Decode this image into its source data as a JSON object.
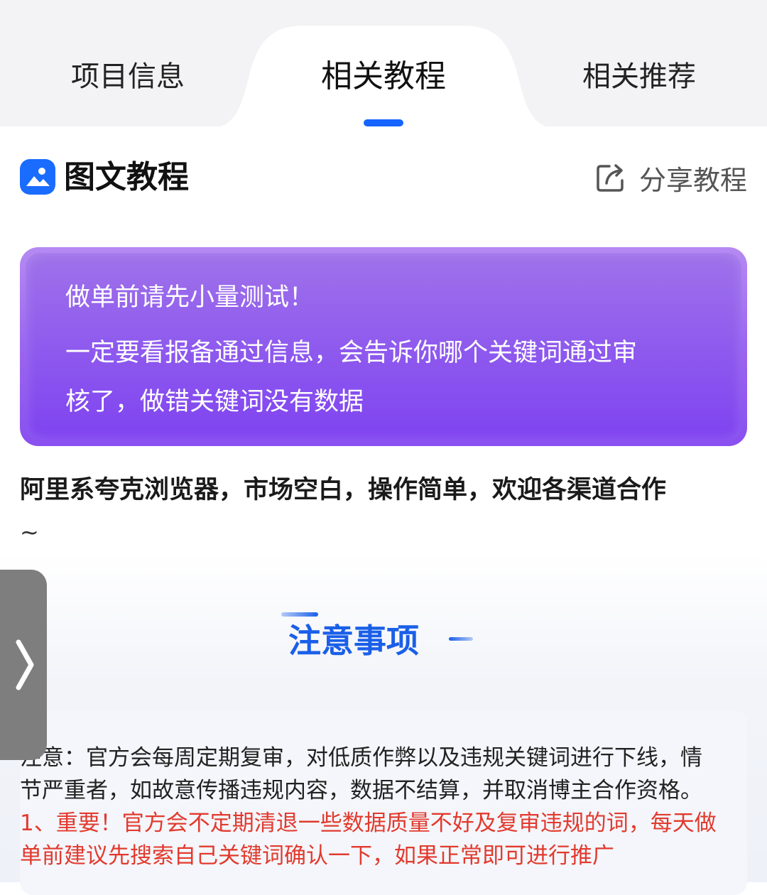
{
  "tabs": [
    {
      "label": "项目信息"
    },
    {
      "label": "相关教程"
    },
    {
      "label": "相关推荐"
    }
  ],
  "active_tab": "相关教程",
  "section": {
    "title": "图文教程",
    "icon": "image-icon",
    "share_label": "分享教程",
    "share_icon": "share-icon"
  },
  "notice": {
    "line1": "做单前请先小量测试！",
    "line2": "一定要看报备通过信息，会告诉你哪个关键词通过审",
    "line3": "核了，做错关键词没有数据"
  },
  "description": {
    "text": "阿里系夸克浏览器，市场空白，操作简单，欢迎各渠道合作",
    "tilde": "~"
  },
  "caution": {
    "title": "注意事项"
  },
  "notes": {
    "paragraph": "注意：官方会每周定期复审，对低质作弊以及违规关键词进行下线，情节严重者，如故意传播违规内容，数据不结算，并取消博主合作资格。",
    "important": "1、重要！官方会不定期清退一些数据质量不好及复审违规的词，每天做单前建议先搜索自己关键词确认一下，如果正常即可进行推广"
  },
  "colors": {
    "accent": "#1664ff",
    "notice_purple": "#8d58ee",
    "warning_red": "#e23a2e",
    "caution_blue": "#1a5fe8"
  }
}
